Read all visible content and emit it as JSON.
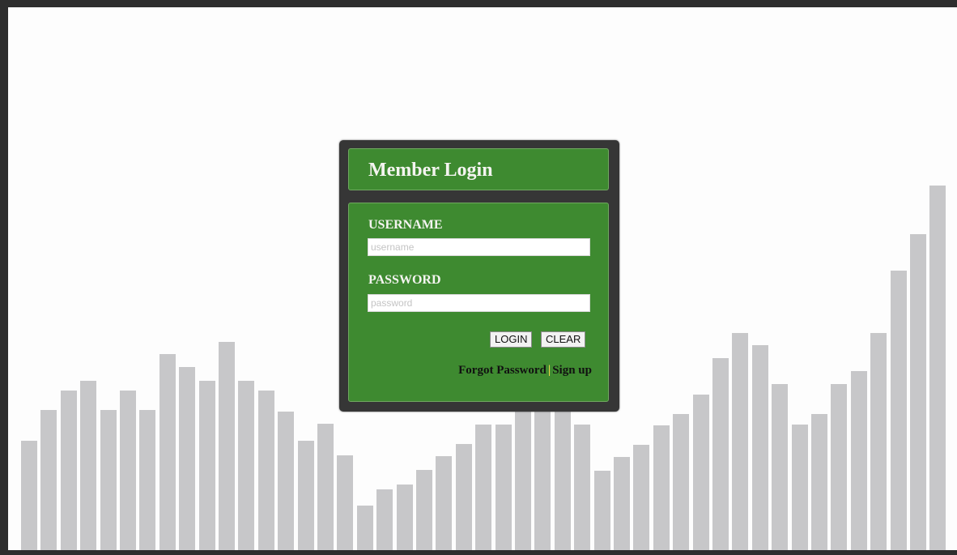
{
  "login": {
    "title": "Member Login",
    "username_label": "USERNAME",
    "username_placeholder": "username",
    "password_label": "PASSWORD",
    "password_placeholder": "password",
    "login_button": "LOGIN",
    "clear_button": "CLEAR",
    "forgot_password_link": "Forgot Password",
    "separator": "|",
    "sign_up_link": "Sign up"
  },
  "background_chart": {
    "color": "#c7c7c9",
    "values": [
      135,
      173,
      197,
      209,
      173,
      197,
      173,
      242,
      226,
      209,
      257,
      209,
      197,
      171,
      135,
      156,
      117,
      55,
      75,
      81,
      99,
      116,
      131,
      155,
      155,
      184,
      188,
      194,
      155,
      98,
      115,
      130,
      154,
      168,
      192,
      237,
      268,
      253,
      205,
      155,
      168,
      205,
      221,
      268,
      345,
      390,
      450
    ]
  },
  "colors": {
    "frame": "#2e2e2e",
    "card_bg": "#363636",
    "panel_green": "#3e8a30",
    "separator": "#e7d24a"
  }
}
